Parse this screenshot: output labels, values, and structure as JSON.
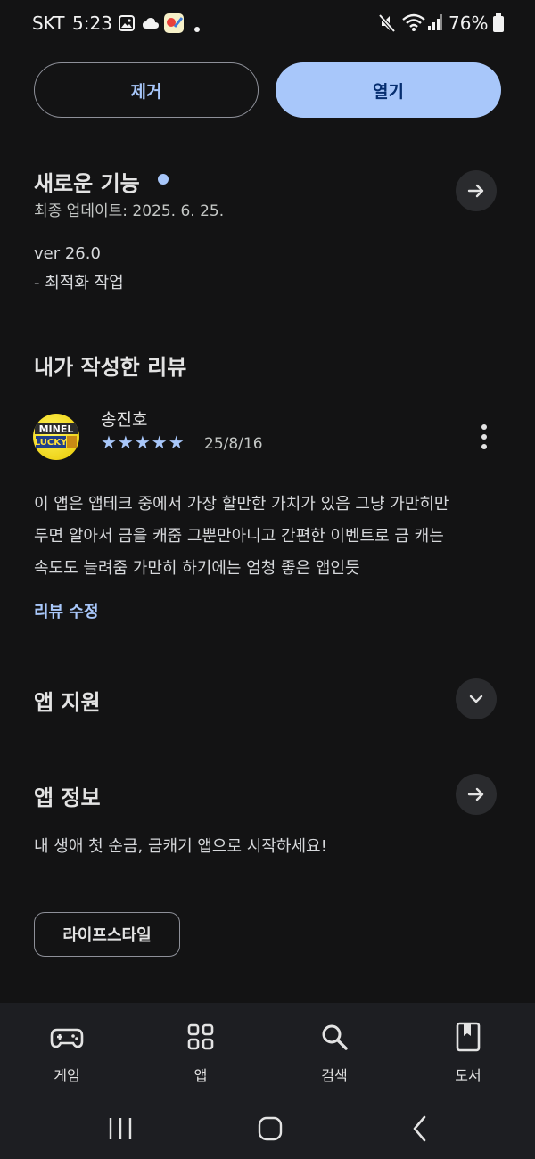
{
  "status_bar": {
    "carrier": "SKT",
    "time": "5:23",
    "battery": "76%"
  },
  "actions": {
    "remove_label": "제거",
    "open_label": "열기"
  },
  "whats_new": {
    "title": "새로운 기능",
    "updated": "최종 업데이트: 2025. 6. 25.",
    "version": "ver 26.0",
    "note": "- 최적화 작업"
  },
  "my_review": {
    "title": "내가 작성한 리뷰",
    "reviewer_name": "송진호",
    "avatar_text_top": "MINEL",
    "avatar_text_bottom": "LUCKY",
    "rating": 5,
    "stars": "★★★★★",
    "date": "25/8/16",
    "lines": [
      "이 앱은 앱테크 중에서 가장 할만한 가치가 있음 그냥 가만히만",
      "두면 알아서 금을 캐줌 그뿐만아니고 간편한 이벤트로 금 캐는",
      "속도도 늘려줌 가만히 하기에는 엄청 좋은 앱인듯"
    ],
    "edit_label": "리뷰 수정"
  },
  "app_support": {
    "title": "앱 지원"
  },
  "app_info": {
    "title": "앱 정보",
    "description": "내 생애 첫 순금, 금캐기 앱으로 시작하세요!",
    "category": "라이프스타일"
  },
  "bottom_nav": {
    "items": [
      {
        "label": "게임",
        "icon": "gamepad-icon"
      },
      {
        "label": "앱",
        "icon": "apps-grid-icon"
      },
      {
        "label": "검색",
        "icon": "search-icon"
      },
      {
        "label": "도서",
        "icon": "book-icon"
      }
    ]
  },
  "colors": {
    "background": "#131314",
    "accent": "#a8c7fa",
    "nav_background": "#1d1e22"
  }
}
